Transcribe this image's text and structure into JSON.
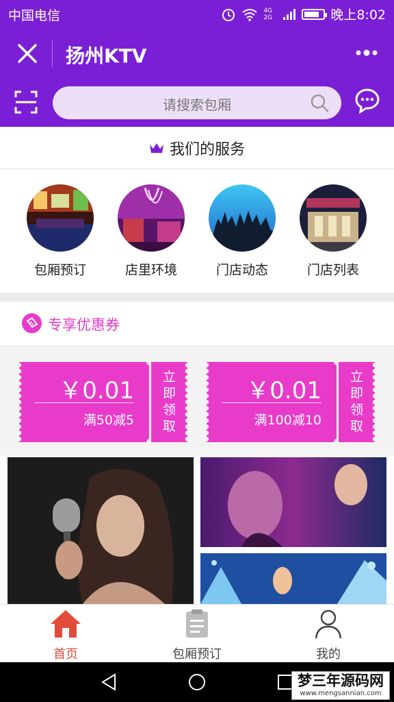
{
  "status_bar": {
    "carrier": "中国电信",
    "network": "4G 2G",
    "time": "晚上8:02"
  },
  "header": {
    "title": "扬州KTV"
  },
  "search": {
    "placeholder": "请搜索包厢"
  },
  "services": {
    "heading": "我们的服务",
    "items": [
      {
        "label": "包厢预订"
      },
      {
        "label": "店里环境"
      },
      {
        "label": "门店动态"
      },
      {
        "label": "门店列表"
      }
    ]
  },
  "coupons": {
    "heading": "专享优惠券",
    "items": [
      {
        "amount": "￥0.01",
        "condition": "满50减5",
        "action_label": [
          "立",
          "即",
          "领",
          "取"
        ]
      },
      {
        "amount": "￥0.01",
        "condition": "满100减10",
        "action_label": [
          "立",
          "即",
          "领",
          "取"
        ]
      }
    ]
  },
  "tabbar": {
    "items": [
      {
        "label": "首页",
        "active": true
      },
      {
        "label": "包厢预订",
        "active": false
      },
      {
        "label": "我的",
        "active": false
      }
    ]
  },
  "watermark": {
    "title": "梦三年源码网",
    "url": "www.mengsannian.com"
  },
  "colors": {
    "brand_purple": "#7b1fd6",
    "coupon_pink": "#e93bc9",
    "tab_active_red": "#e24a3a"
  }
}
